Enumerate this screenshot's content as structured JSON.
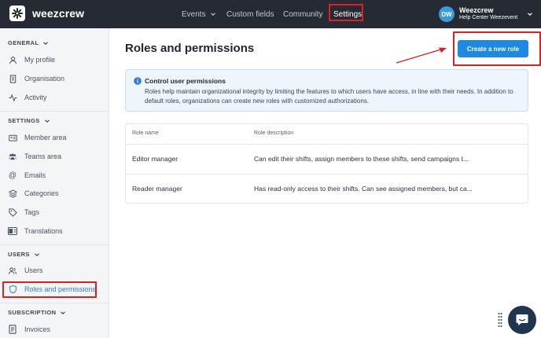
{
  "app": {
    "logo_text": "weezcrew"
  },
  "nav": {
    "items": [
      {
        "label": "Events"
      },
      {
        "label": "Custom fields"
      },
      {
        "label": "Community"
      },
      {
        "label": "Settings"
      }
    ],
    "active": "Settings"
  },
  "user": {
    "initials": "DW",
    "name": "Weezcrew",
    "subtitle": "Help Center Weezevent"
  },
  "sidebar": {
    "sections": [
      {
        "title": "GENERAL",
        "items": [
          {
            "label": "My profile",
            "icon": "user-icon"
          },
          {
            "label": "Organisation",
            "icon": "building-icon"
          },
          {
            "label": "Activity",
            "icon": "activity-icon"
          }
        ]
      },
      {
        "title": "SETTINGS",
        "items": [
          {
            "label": "Member area",
            "icon": "id-card-icon"
          },
          {
            "label": "Teams area",
            "icon": "team-icon"
          },
          {
            "label": "Emails",
            "icon": "at-icon"
          },
          {
            "label": "Categories",
            "icon": "layers-icon"
          },
          {
            "label": "Tags",
            "icon": "tag-icon"
          },
          {
            "label": "Translations",
            "icon": "translate-icon"
          }
        ]
      },
      {
        "title": "USERS",
        "items": [
          {
            "label": "Users",
            "icon": "users-icon"
          },
          {
            "label": "Roles and permissions",
            "icon": "shield-icon"
          }
        ]
      },
      {
        "title": "SUBSCRIPTION",
        "items": [
          {
            "label": "Invoices",
            "icon": "invoice-icon"
          }
        ]
      }
    ],
    "active_item": "Roles and permissions"
  },
  "main": {
    "title": "Roles and permissions",
    "create_button": "Create a new role",
    "info": {
      "title": "Control user permissions",
      "body": "Roles help maintain organizational integrity by limiting the features to which users have access, in line with their needs. In addition to default roles, organizations can create new roles with customized authorizations."
    },
    "table": {
      "headers": [
        "Role name",
        "Role description"
      ],
      "rows": [
        {
          "name": "Editor manager",
          "description": "Can edit their shifts, assign members to these shifts, send campaigns t..."
        },
        {
          "name": "Reader manager",
          "description": "Has read-only access to their shifts. Can see assigned members, but ca..."
        }
      ]
    }
  },
  "colors": {
    "topbar": "#262b33",
    "accent": "#1e88e5",
    "annotation": "#e02020",
    "help_button": "#1f3550"
  }
}
